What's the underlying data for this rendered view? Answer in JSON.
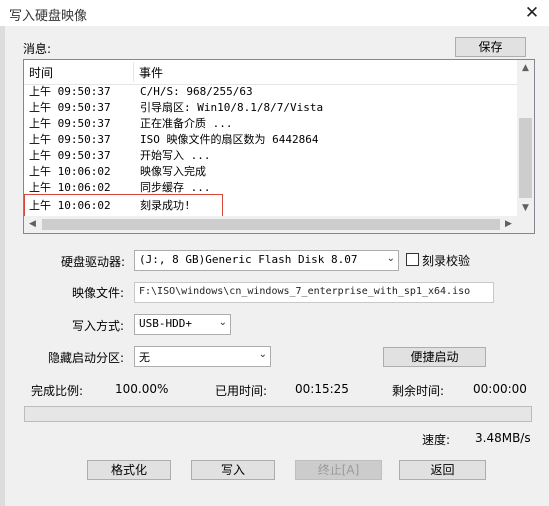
{
  "window": {
    "title": "写入硬盘映像",
    "close_glyph": "✕"
  },
  "messages": {
    "label": "消息:",
    "save_label": "保存",
    "col_time": "时间",
    "col_event": "事件",
    "rows": [
      {
        "time": "上午 09:50:37",
        "event": "C/H/S: 968/255/63"
      },
      {
        "time": "上午 09:50:37",
        "event": "引导扇区: Win10/8.1/8/7/Vista"
      },
      {
        "time": "上午 09:50:37",
        "event": "正在准备介质 ..."
      },
      {
        "time": "上午 09:50:37",
        "event": "ISO 映像文件的扇区数为 6442864"
      },
      {
        "time": "上午 09:50:37",
        "event": "开始写入 ..."
      },
      {
        "time": "上午 10:06:02",
        "event": "映像写入完成"
      },
      {
        "time": "上午 10:06:02",
        "event": "同步缓存 ..."
      },
      {
        "time": "上午 10:06:02",
        "event": "刻录成功!"
      }
    ],
    "highlight_color": "#d9483b"
  },
  "form": {
    "drive_label": "硬盘驱动器:",
    "drive_value": "(J:, 8 GB)Generic Flash Disk       8.07",
    "verify_label": "刻录校验",
    "verify_checked": false,
    "image_label": "映像文件:",
    "image_value": "F:\\ISO\\windows\\cn_windows_7_enterprise_with_sp1_x64.iso",
    "mode_label": "写入方式:",
    "mode_value": "USB-HDD+",
    "hidden_label": "隐藏启动分区:",
    "hidden_value": "无",
    "quickboot_label": "便捷启动"
  },
  "status": {
    "complete_label": "完成比例:",
    "complete_value": "100.00%",
    "progress_fraction": 1.0,
    "elapsed_label": "已用时间:",
    "elapsed_value": "00:15:25",
    "remaining_label": "剩余时间:",
    "remaining_value": "00:00:00",
    "speed_label": "速度:",
    "speed_value": "3.48MB/s"
  },
  "buttons": {
    "format": "格式化",
    "write": "写入",
    "stop": "终止[A]",
    "back": "返回"
  },
  "icons": {
    "vscroll_up": "▲",
    "vscroll_down": "▼",
    "hscroll_left": "◀",
    "hscroll_right": "▶",
    "combo_arrow": "⌄"
  }
}
